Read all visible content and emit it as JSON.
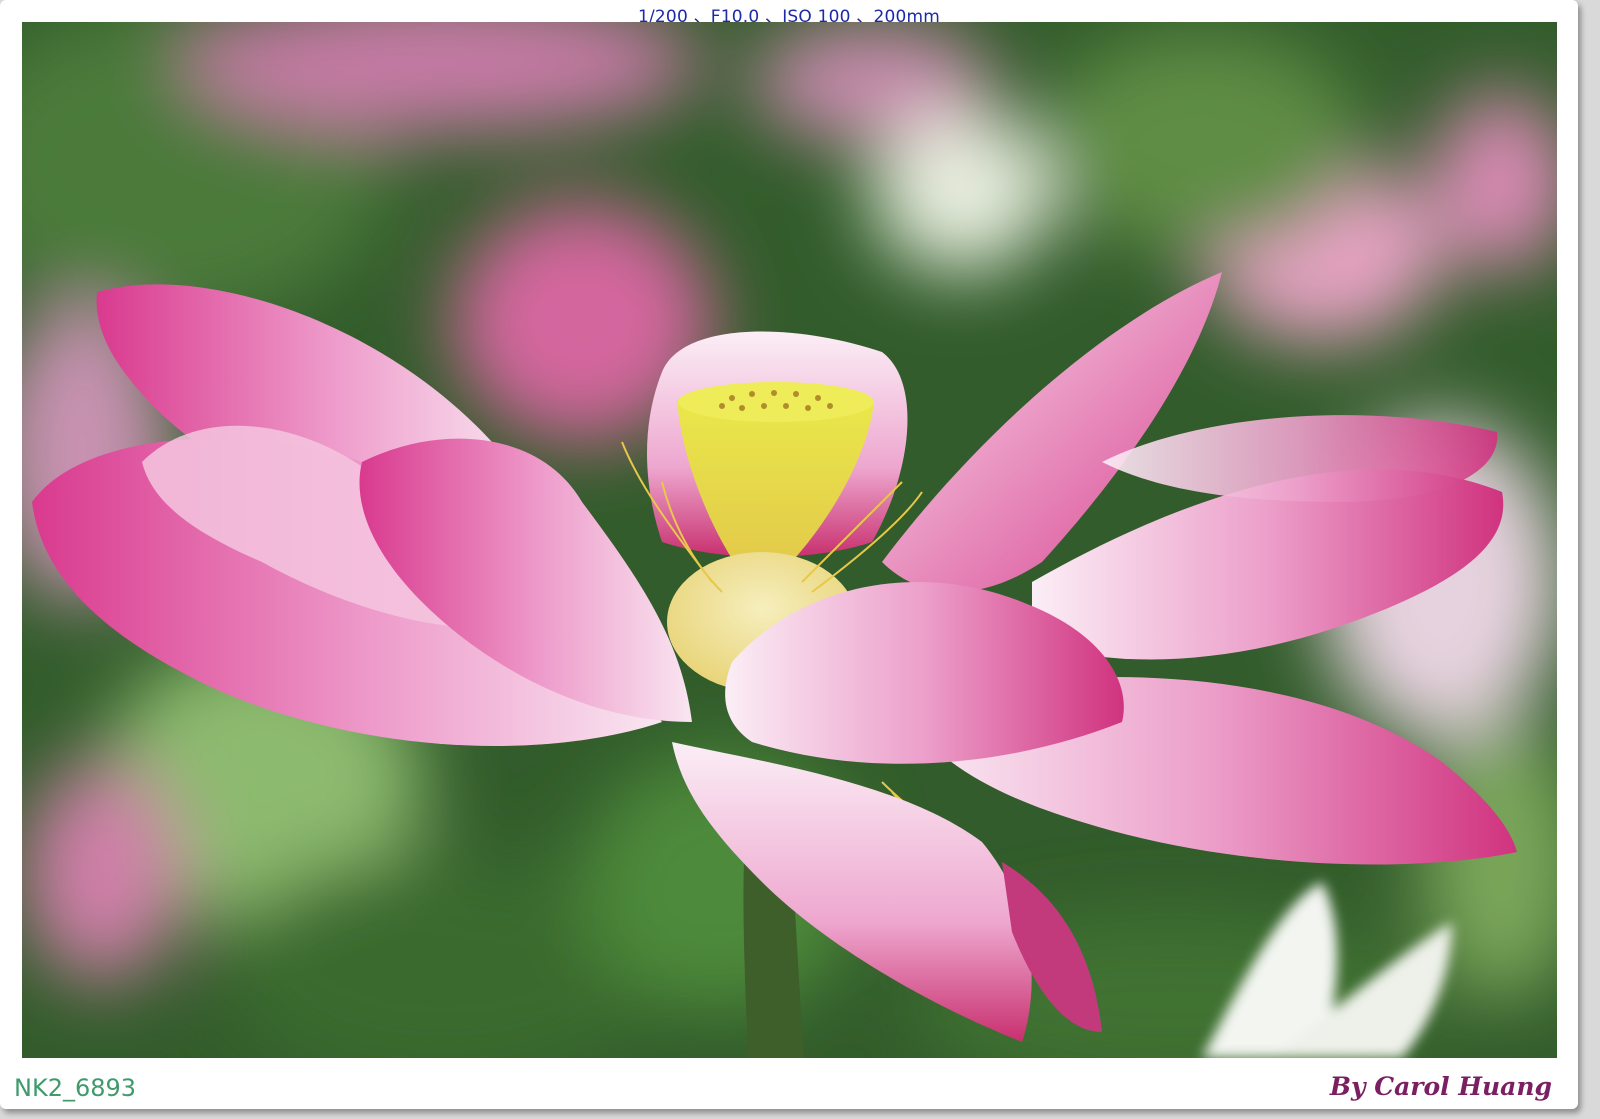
{
  "header": {
    "exif_line": "1/200 、F10.0 、ISO 100 、200mm"
  },
  "photo": {
    "subject": "pink-lotus-flower",
    "colors": {
      "petal_deep": "#d93a8e",
      "petal_light": "#f6d2e8",
      "seedpod": "#e4e23a",
      "stamens": "#f1e6a8",
      "background_green": "#2f5a28"
    }
  },
  "footer": {
    "file_id": "NK2_6893",
    "credit": "By Carol Huang"
  }
}
